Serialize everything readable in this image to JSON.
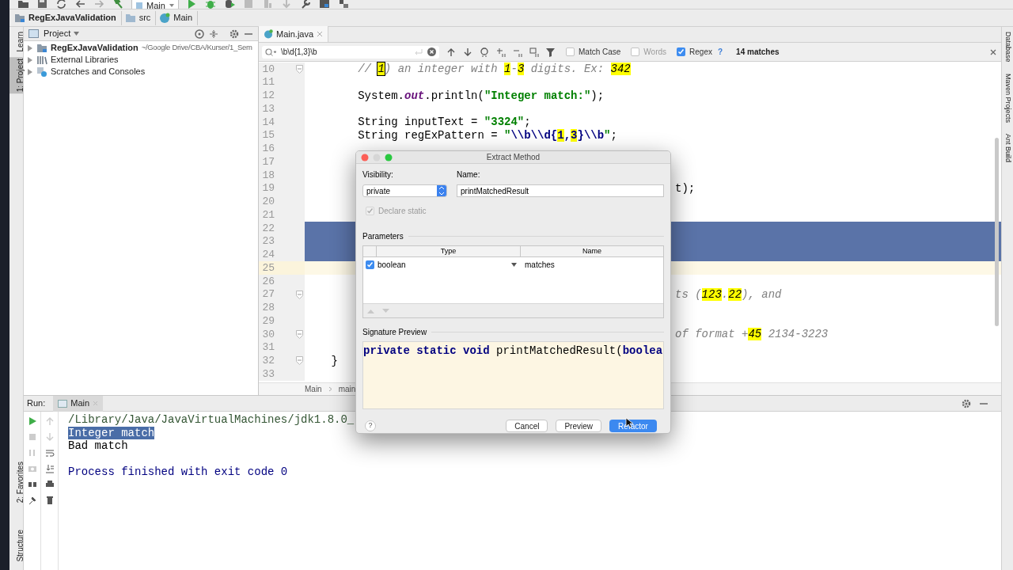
{
  "toolbar": {
    "run_config": "Main"
  },
  "breadcrumbs": [
    {
      "label": "RegExJavaValidation",
      "kind": "module"
    },
    {
      "label": "src",
      "kind": "folder"
    },
    {
      "label": "Main",
      "kind": "class"
    }
  ],
  "left_stripe": {
    "top": [
      {
        "label": "Learn",
        "selected": false
      },
      {
        "label": "1: Project",
        "selected": true
      }
    ],
    "bottom": [
      {
        "label": "2: Favorites",
        "selected": false
      },
      {
        "label": "Structure",
        "selected": false
      }
    ]
  },
  "project_panel": {
    "title": "Project",
    "tree": [
      {
        "label": "RegExJavaValidation",
        "path": "~/Google Drive/CBA/Kurser/1_Sem",
        "kind": "module",
        "expanded": false
      },
      {
        "label": "External Libraries",
        "kind": "libraries",
        "expanded": false
      },
      {
        "label": "Scratches and Consoles",
        "kind": "scratches",
        "expanded": false
      }
    ]
  },
  "editor": {
    "tabs": [
      {
        "label": "Main.java",
        "selected": true
      }
    ],
    "search": {
      "value": "\\b\\d{1,3}\\b",
      "options": [
        {
          "label": "Match Case",
          "checked": false,
          "disabled": false
        },
        {
          "label": "Words",
          "checked": false,
          "disabled": true
        },
        {
          "label": "Regex",
          "checked": true,
          "disabled": false
        }
      ],
      "help": "?",
      "match_count": "14 matches"
    },
    "lines": [
      {
        "number": "10",
        "fold": true,
        "selected": false,
        "current": false,
        "segments": [
          {
            "text": "        // ",
            "kind": "comment"
          },
          {
            "text": "1",
            "kind": "comment-current-hit"
          },
          {
            "text": ") an integer with ",
            "kind": "comment"
          },
          {
            "text": "1",
            "kind": "comment-hit"
          },
          {
            "text": "-",
            "kind": "comment"
          },
          {
            "text": "3",
            "kind": "comment-hit"
          },
          {
            "text": " digits. Ex: ",
            "kind": "comment"
          },
          {
            "text": "342",
            "kind": "comment-hit"
          }
        ]
      },
      {
        "number": "11",
        "fold": false,
        "selected": false,
        "current": false
      },
      {
        "number": "12",
        "fold": false,
        "selected": false,
        "current": false,
        "segments": [
          {
            "text": "        System.",
            "kind": "plain"
          },
          {
            "text": "out",
            "kind": "field"
          },
          {
            "text": ".println(",
            "kind": "plain"
          },
          {
            "text": "\"Integer match:\"",
            "kind": "string"
          },
          {
            "text": ");",
            "kind": "plain"
          }
        ]
      },
      {
        "number": "13",
        "fold": false,
        "selected": false,
        "current": false
      },
      {
        "number": "14",
        "fold": false,
        "selected": false,
        "current": false,
        "segments": [
          {
            "text": "        String inputText = ",
            "kind": "plain"
          },
          {
            "text": "\"3324\"",
            "kind": "string"
          },
          {
            "text": ";",
            "kind": "plain"
          }
        ]
      },
      {
        "number": "15",
        "fold": false,
        "selected": false,
        "current": false,
        "segments": [
          {
            "text": "        String regExPattern = ",
            "kind": "plain"
          },
          {
            "text": "\"",
            "kind": "string"
          },
          {
            "text": "\\\\b\\\\d{",
            "kind": "escape"
          },
          {
            "text": "1",
            "kind": "escape-hit"
          },
          {
            "text": ",",
            "kind": "escape"
          },
          {
            "text": "3",
            "kind": "escape-hit"
          },
          {
            "text": "}\\\\b",
            "kind": "escape"
          },
          {
            "text": "\"",
            "kind": "string"
          },
          {
            "text": ";",
            "kind": "plain"
          }
        ]
      },
      {
        "number": "16",
        "fold": false,
        "selected": false,
        "current": false
      },
      {
        "number": "17",
        "fold": false,
        "selected": false,
        "current": false
      },
      {
        "number": "18",
        "fold": false,
        "selected": false,
        "current": false
      },
      {
        "number": "19",
        "fold": false,
        "selected": false,
        "current": false,
        "tail": [
          {
            "text": "t);",
            "kind": "plain"
          }
        ]
      },
      {
        "number": "20",
        "fold": false,
        "selected": false,
        "current": false
      },
      {
        "number": "21",
        "fold": false,
        "selected": false,
        "current": false
      },
      {
        "number": "22",
        "fold": false,
        "selected": true,
        "current": false
      },
      {
        "number": "23",
        "fold": false,
        "selected": true,
        "current": false
      },
      {
        "number": "24",
        "fold": false,
        "selected": true,
        "current": false
      },
      {
        "number": "25",
        "fold": false,
        "selected": false,
        "current": true
      },
      {
        "number": "26",
        "fold": false,
        "selected": false,
        "current": false
      },
      {
        "number": "27",
        "fold": true,
        "selected": false,
        "current": false,
        "tail": [
          {
            "text": "ts (",
            "kind": "comment"
          },
          {
            "text": "123",
            "kind": "comment-hit"
          },
          {
            "text": ".",
            "kind": "comment"
          },
          {
            "text": "22",
            "kind": "comment-hit"
          },
          {
            "text": "), and",
            "kind": "comment"
          }
        ]
      },
      {
        "number": "28",
        "fold": false,
        "selected": false,
        "current": false
      },
      {
        "number": "29",
        "fold": false,
        "selected": false,
        "current": false
      },
      {
        "number": "30",
        "fold": true,
        "selected": false,
        "current": false,
        "tail": [
          {
            "text": "of format +",
            "kind": "comment"
          },
          {
            "text": "45",
            "kind": "comment-hit"
          },
          {
            "text": " 2134-3223",
            "kind": "comment"
          }
        ]
      },
      {
        "number": "31",
        "fold": false,
        "selected": false,
        "current": false
      },
      {
        "number": "32",
        "fold": true,
        "selected": false,
        "current": false,
        "segments": [
          {
            "text": "    }",
            "kind": "plain"
          }
        ]
      },
      {
        "number": "33",
        "fold": false,
        "selected": false,
        "current": false
      }
    ],
    "breadcrumbs": [
      "Main",
      "main"
    ]
  },
  "right_stripe": [
    "Database",
    "Maven Projects",
    "Ant Build"
  ],
  "run_panel": {
    "label": "Run:",
    "tabs": [
      {
        "label": "Main",
        "selected": true
      }
    ],
    "console": [
      {
        "text": "/Library/Java/JavaVirtualMachines/jdk1.8.0_",
        "kind": "command"
      },
      {
        "text": "Integer match",
        "kind": "selected-output"
      },
      {
        "text": "Bad match",
        "kind": "output"
      },
      {
        "kind": "blank"
      },
      {
        "text": "Process finished with exit code 0",
        "kind": "system"
      }
    ]
  },
  "dialog": {
    "title": "Extract Method",
    "visibility_label": "Visibility:",
    "visibility": "private",
    "name_label": "Name:",
    "name": "printMatchedResult",
    "declare_static": {
      "label": "Declare static",
      "checked": true,
      "disabled": true
    },
    "parameters_label": "Parameters",
    "columns": [
      "Type",
      "Name"
    ],
    "parameters": [
      {
        "type": "boolean",
        "name": "matches",
        "checked": true
      }
    ],
    "preview_label": "Signature Preview",
    "preview": [
      {
        "text": "private static void",
        "kind": "keyword"
      },
      {
        "text": " printMatchedResult(",
        "kind": "plain"
      },
      {
        "text": "boolea",
        "kind": "keyword"
      }
    ],
    "help": "?",
    "buttons": [
      {
        "label": "Cancel",
        "default": false
      },
      {
        "label": "Preview",
        "default": false
      },
      {
        "label": "Refactor",
        "default": true
      }
    ]
  }
}
